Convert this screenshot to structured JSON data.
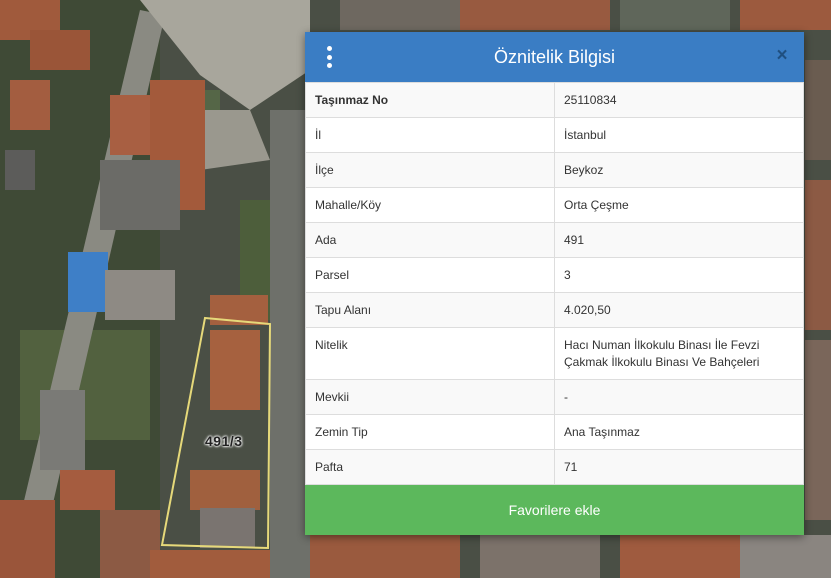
{
  "panel": {
    "title": "Öznitelik Bilgisi",
    "menu_icon": "vertical-ellipsis-icon",
    "close_label": "×",
    "header_color": "#3a7dc4",
    "rows": [
      {
        "key": "Taşınmaz No",
        "value": "25110834"
      },
      {
        "key": "İl",
        "value": "İstanbul"
      },
      {
        "key": "İlçe",
        "value": "Beykoz"
      },
      {
        "key": "Mahalle/Köy",
        "value": "Orta Çeşme"
      },
      {
        "key": "Ada",
        "value": "491"
      },
      {
        "key": "Parsel",
        "value": "3"
      },
      {
        "key": "Tapu Alanı",
        "value": "4.020,50"
      },
      {
        "key": "Nitelik",
        "value": "Hacı Numan İlkokulu Binası İle Fevzi Çakmak İlkokulu Binası Ve Bahçeleri"
      },
      {
        "key": "Mevkii",
        "value": "-"
      },
      {
        "key": "Zemin Tip",
        "value": "Ana Taşınmaz"
      },
      {
        "key": "Pafta",
        "value": "71"
      }
    ],
    "favorite_button": "Favorilere ekle",
    "favorite_color": "#5cb85c"
  },
  "map": {
    "parcel_label": "491/3",
    "parcel_outline_color": "#e6d97a"
  }
}
